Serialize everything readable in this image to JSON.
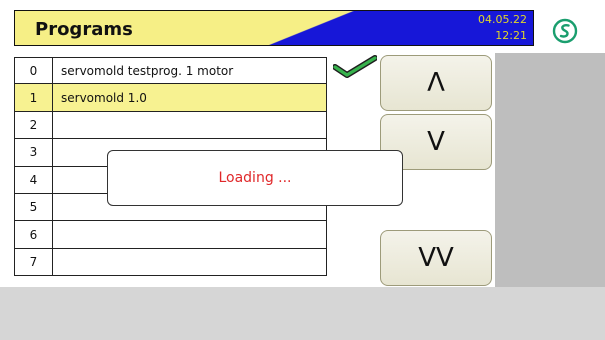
{
  "header": {
    "title": "Programs",
    "date": "04.05.22",
    "time": "12:21"
  },
  "programs": [
    {
      "index": "0",
      "name": "servomold testprog. 1 motor"
    },
    {
      "index": "1",
      "name": "servomold 1.0"
    },
    {
      "index": "2",
      "name": ""
    },
    {
      "index": "3",
      "name": ""
    },
    {
      "index": "4",
      "name": ""
    },
    {
      "index": "5",
      "name": ""
    },
    {
      "index": "6",
      "name": ""
    },
    {
      "index": "7",
      "name": ""
    }
  ],
  "selected_index": 1,
  "buttons": {
    "up": "Λ",
    "down": "V",
    "page_down": "VV"
  },
  "dialog": {
    "message": "Loading ..."
  },
  "colors": {
    "header_yellow": "#f6ef86",
    "header_blue": "#1717d8",
    "selected_row": "#f7f291",
    "loading_text": "#e0282a",
    "logo_green": "#1a9e6e"
  },
  "icons": {
    "logo": "servomold-logo-icon",
    "check": "checkmark-icon"
  }
}
